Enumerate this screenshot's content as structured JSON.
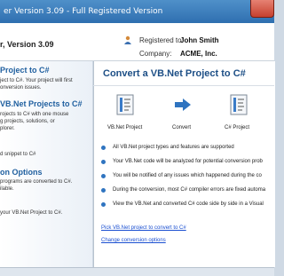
{
  "window": {
    "title": "er Version 3.09 - Full Registered Version"
  },
  "header": {
    "version_text": "r, Version 3.09",
    "registered_label": "Registered to:",
    "registered_value": "John Smith",
    "company_label": "Company:",
    "company_value": "ACME, Inc."
  },
  "sidebar": {
    "section1_title": "Project to C#",
    "section1_lines": [
      "ject to C#.  Your project will first",
      "onversion issues."
    ],
    "section2_title": "VB.Net Projects to C#",
    "section2_lines": [
      "rojects to C# with one mouse",
      "g projects, solutions, or",
      "plorer."
    ],
    "snippet_text": "d snippet to C#",
    "section3_title": "on Options",
    "section3_lines": [
      "programs are converted to C#.",
      "ilable."
    ],
    "bottom_text": "your VB.Net Project to C#."
  },
  "main": {
    "title": "Convert a VB.Net Project to C#",
    "flow": [
      {
        "label": "VB.Net Project",
        "icon": "vb-project-icon"
      },
      {
        "label": "Convert",
        "icon": "convert-arrow-icon"
      },
      {
        "label": "C# Project",
        "icon": "cs-project-icon"
      }
    ],
    "bullets": [
      "All VB.Net project types and features are supported",
      "Your VB.Net code will be analyzed for potential conversion prob",
      "You will be notified of any issues which happened during the co",
      "During the conversion, most C# compiler errors are fixed automa",
      "View the VB.Net and converted C# code side by side in a Visual"
    ],
    "link_pick": "Pick VB.Net project to convert to C#",
    "link_options": "Change conversion options"
  },
  "colors": {
    "accent": "#1d4f86",
    "link": "#1a4fd1",
    "bullet": "#2f74c0"
  }
}
